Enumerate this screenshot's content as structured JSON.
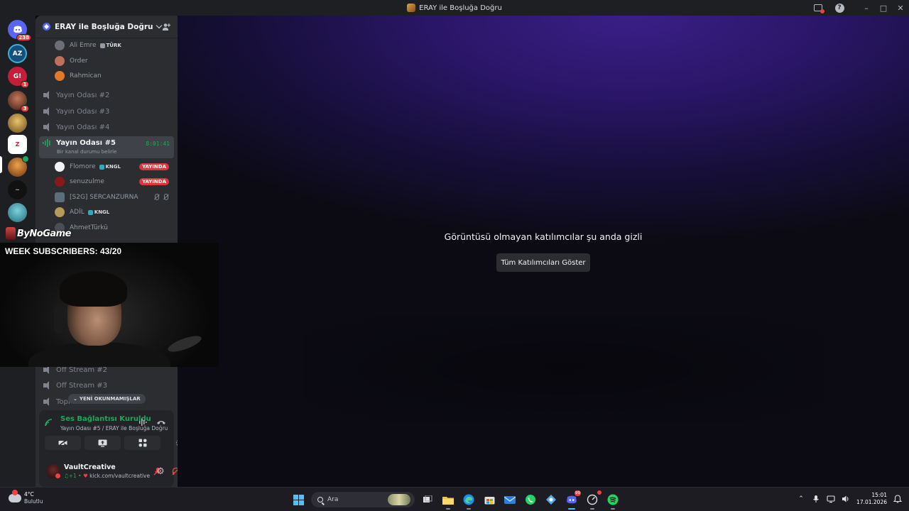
{
  "window": {
    "title": "ERAY ile Boşluğa Doğru"
  },
  "rail": {
    "servers": [
      {
        "name": "direct-messages",
        "badge": "238",
        "color": "#5865f2"
      },
      {
        "name": "az-server",
        "badge": "",
        "color": "#1a6fa8"
      },
      {
        "name": "gk-server",
        "badge": "1",
        "color": "#c41e3a"
      },
      {
        "name": "avatar-server",
        "badge": "3",
        "color": "#7a3b2e"
      },
      {
        "name": "cartoon-server",
        "badge": "",
        "color": "#caa04a"
      },
      {
        "name": "zuno-server",
        "badge": "",
        "color": "#ffffff"
      },
      {
        "name": "active-server",
        "badge": "",
        "color": "#e08a2e"
      },
      {
        "name": "dark-server",
        "badge": "",
        "color": "#222222"
      },
      {
        "name": "cyan-server",
        "badge": "",
        "color": "#3aa6b9"
      }
    ]
  },
  "sidebar": {
    "guild_name": "ERAY ile Boşluğa Doğru",
    "top_members": [
      {
        "name": "Ali Emre",
        "tag": "TÜRK"
      },
      {
        "name": "Order",
        "tag": ""
      },
      {
        "name": "Rahmican",
        "tag": ""
      }
    ],
    "channels": [
      {
        "name": "Yayın Odası #2"
      },
      {
        "name": "Yayın Odası #3"
      },
      {
        "name": "Yayın Odası #4"
      }
    ],
    "active_channel": {
      "name": "Yayın Odası #5",
      "status": "Bir kanal durumu belirle",
      "timer": "8:01:41"
    },
    "voice_members": [
      {
        "name": "Flomore",
        "tag": "KNGL",
        "live": "YAYINDA"
      },
      {
        "name": "senuzulme",
        "tag": "",
        "live": "YAYINDA"
      },
      {
        "name": "[S2G] SERCANZURNA",
        "tag": "",
        "live": ""
      },
      {
        "name": "ADİL",
        "tag": "KNGL",
        "live": ""
      },
      {
        "name": "AhmetTürkü",
        "tag": "",
        "live": ""
      }
    ],
    "bottom_channels": [
      {
        "name": "Off Stream #2"
      },
      {
        "name": "Off Stream #3"
      },
      {
        "name": "Topl"
      }
    ],
    "unread_pill": "YENİ OKUNMAMIŞLAR"
  },
  "voice_panel": {
    "title": "Ses Bağlantısı Kuruldu",
    "subtitle": "Yayın Odası #5 / ERAY ile Boşluğa Doğru"
  },
  "user": {
    "name": "VaultCreative",
    "status_prefix": "♫+1 •",
    "status_link": "kick.com/vaultcreative"
  },
  "main": {
    "hidden_message": "Görüntüsü olmayan katılımcılar şu anda gizli",
    "show_button": "Tüm Katılımcıları Göster"
  },
  "overlay": {
    "logo_text": "ByNoGame",
    "sub_counter": "WEEK SUBSCRIBERS: 43/20"
  },
  "taskbar": {
    "weather_temp": "4°C",
    "weather_desc": "Bulutlu",
    "search_placeholder": "Ara",
    "time": "15:01",
    "date": "17.01.2026"
  },
  "colors": {
    "accent": "#5865f2",
    "online_green": "#23a55a",
    "live_red": "#da373c"
  }
}
